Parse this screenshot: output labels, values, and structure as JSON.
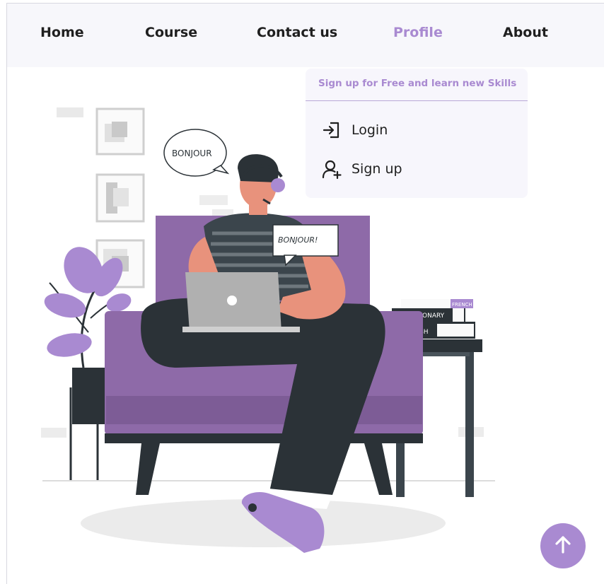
{
  "nav": {
    "items": [
      {
        "label": "Home",
        "active": false
      },
      {
        "label": "Course",
        "active": false
      },
      {
        "label": "Contact us",
        "active": false
      },
      {
        "label": "Profile",
        "active": true
      },
      {
        "label": "About",
        "active": false
      }
    ]
  },
  "profile_menu": {
    "header": "Sign up for Free and learn new Skills",
    "items": [
      {
        "label": "Login",
        "icon": "login-icon"
      },
      {
        "label": "Sign up",
        "icon": "add-user-icon"
      }
    ]
  },
  "illustration": {
    "speech_left": "BONJOUR",
    "speech_right": "BONJOUR!",
    "book_top": "FRENCH",
    "book_middle": "DICTIONARY",
    "book_bottom": "ENGLISH"
  },
  "scroll_top": {
    "icon": "arrow-up-icon"
  },
  "colors": {
    "accent": "#a98ad1",
    "sofa": "#8e6aa8",
    "dark": "#2b3237",
    "skin": "#e8927c",
    "navbar_bg": "#f7f7fb"
  }
}
